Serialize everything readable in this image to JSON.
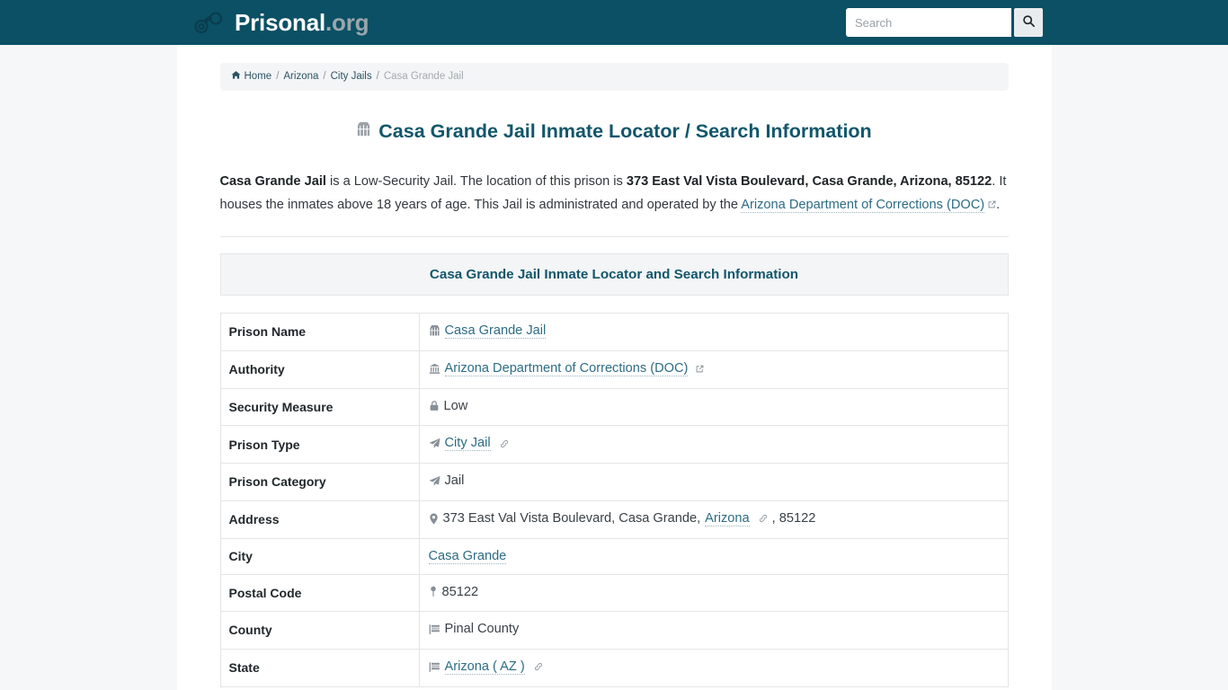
{
  "header": {
    "brand_name": "Prisonal",
    "brand_tld": ".org",
    "logo_icon": "handcuffs-icon",
    "search": {
      "placeholder": "Search",
      "value": "",
      "button_icon": "search-icon"
    }
  },
  "breadcrumb": {
    "home_icon": "home-icon",
    "items": [
      {
        "label": "Home",
        "link": true
      },
      {
        "label": "Arizona",
        "link": true
      },
      {
        "label": "City Jails",
        "link": true
      },
      {
        "label": "Casa Grande Jail",
        "link": false
      }
    ],
    "separator": "/"
  },
  "main": {
    "title": "Casa Grande Jail Inmate Locator / Search Information",
    "title_icon": "jail-building-icon",
    "lead": {
      "prison_name": "Casa Grande Jail",
      "text_1": " is a Low-Security Jail. The location of this prison is ",
      "address_bold": "373 East Val Vista Boulevard, Casa Grande, Arizona, 85122",
      "text_2": ". It houses the inmates above 18 years of age. This Jail is administrated and operated by the ",
      "authority_link": "Arizona Department of Corrections (DOC)",
      "text_3": "."
    },
    "table_caption": "Casa Grande Jail Inmate Locator and Search Information",
    "rows": [
      {
        "label": "Prison Name",
        "icon": "jail-building-icon",
        "value": "Casa Grande Jail",
        "is_link": true,
        "external": false,
        "chain": false
      },
      {
        "label": "Authority",
        "icon": "bank-icon",
        "value": "Arizona Department of Corrections (DOC)",
        "is_link": true,
        "external": true,
        "chain": false
      },
      {
        "label": "Security Measure",
        "icon": "lock-icon",
        "value": "Low",
        "is_link": false,
        "external": false,
        "chain": false
      },
      {
        "label": "Prison Type",
        "icon": "paper-plane-icon",
        "value": "City Jail",
        "is_link": true,
        "external": false,
        "chain": true
      },
      {
        "label": "Prison Category",
        "icon": "paper-plane-icon",
        "value": "Jail",
        "is_link": false,
        "external": false,
        "chain": false
      },
      {
        "label": "Address",
        "icon": "map-pin-icon",
        "value_prefix": "373 East Val Vista Boulevard, Casa Grande, ",
        "value_link": "Arizona",
        "value_suffix": ", 85122",
        "is_link": false,
        "external": false,
        "chain": true,
        "composite": true
      },
      {
        "label": "City",
        "icon": "",
        "value": "Casa Grande",
        "is_link": true,
        "external": false,
        "chain": false
      },
      {
        "label": "Postal Code",
        "icon": "map-marker-icon",
        "value": "85122",
        "is_link": false,
        "external": false,
        "chain": false
      },
      {
        "label": "County",
        "icon": "flag-icon",
        "value": "Pinal County",
        "is_link": false,
        "external": false,
        "chain": false
      },
      {
        "label": "State",
        "icon": "flag-icon",
        "value": "Arizona ( AZ )",
        "is_link": true,
        "external": false,
        "chain": true
      }
    ]
  },
  "colors": {
    "header_bg": "#0b5064",
    "brand_text": "#ffffff",
    "brand_tld": "#9aa6ab",
    "title": "#12566b",
    "link": "#2c6c84",
    "icon_gray": "#868e96",
    "page_bg": "#f5f7f8",
    "panel_bg": "#f4f5f6",
    "border": "#e3e5e7"
  }
}
